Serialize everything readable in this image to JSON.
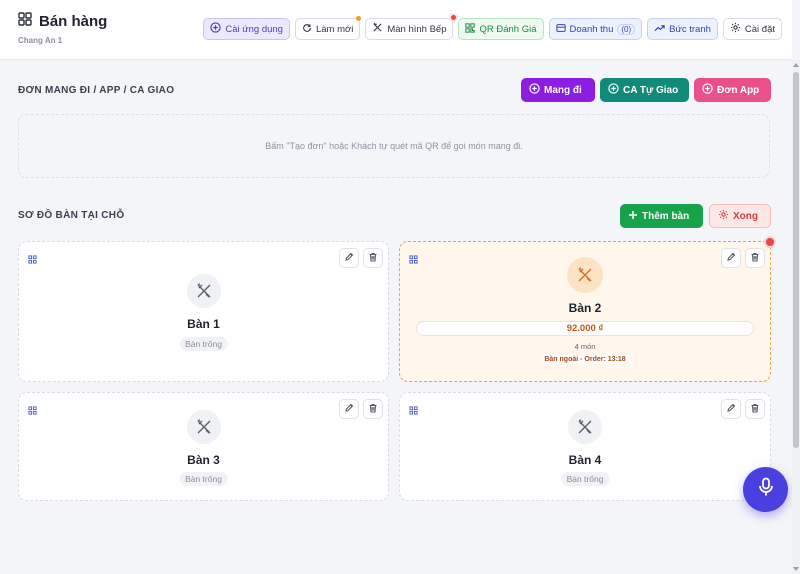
{
  "header": {
    "title": "Bán hàng",
    "subtitle": "Chang An 1"
  },
  "toolbar": {
    "install_app": "Cài ứng dụng",
    "refresh": "Làm mới",
    "kitchen": "Màn hình Bếp",
    "qr_review": "QR Đánh Giá",
    "revenue": "Doanh thu",
    "revenue_count": "(0)",
    "picture": "Bức tranh",
    "settings": "Cài đặt"
  },
  "takeaway": {
    "title": "ĐƠN MANG ĐI / APP / CA GIAO",
    "btn_takeaway": "Mang đi",
    "btn_self_delivery": "CA Tự Giao",
    "btn_app_order": "Đơn App",
    "empty_text": "Bấm \"Tạo đơn\" hoặc Khách tự quét mã QR để gọi món mang đi."
  },
  "dine_in": {
    "title": "SƠ ĐỒ BÀN TẠI CHỖ",
    "btn_add_table": "Thêm bàn",
    "btn_done": "Xong"
  },
  "tables": [
    {
      "name": "Bàn 1",
      "status": "Bàn trống"
    },
    {
      "name": "Bàn 2",
      "price": "92.000 ₫",
      "items": "4 món",
      "order": "Bàn ngoài - Order: 13:18"
    },
    {
      "name": "Bàn 3",
      "status": "Bàn trống"
    },
    {
      "name": "Bàn 4",
      "status": "Bàn trống"
    }
  ],
  "colors": {
    "accent": "#4a3fe0",
    "purple": "#8b1ee0",
    "teal": "#128a7a",
    "pink": "#e9508c",
    "green": "#16a34a",
    "danger": "#e84545"
  }
}
